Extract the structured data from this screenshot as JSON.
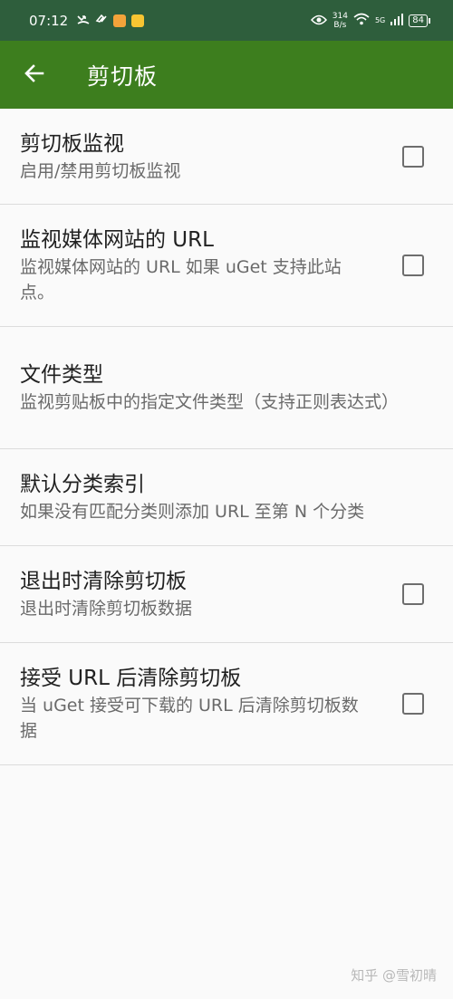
{
  "status_bar": {
    "time": "07:12",
    "net_speed_value": "314",
    "net_speed_unit": "B/s",
    "network_type": "5G",
    "battery": "84",
    "icons": [
      "missed-call-icon",
      "app-icon",
      "app-icon",
      "app-icon",
      "eye-icon",
      "wifi-icon",
      "signal-icon",
      "battery-icon"
    ]
  },
  "app_bar": {
    "title": "剪切板",
    "back_icon": "arrow-back-icon",
    "color": "#3d7e1e"
  },
  "preferences": [
    {
      "title": "剪切板监视",
      "summary": "启用/禁用剪切板监视",
      "has_checkbox": true,
      "checked": false
    },
    {
      "title": "监视媒体网站的 URL",
      "summary": "监视媒体网站的 URL 如果 uGet 支持此站点。",
      "has_checkbox": true,
      "checked": false
    },
    {
      "title": "文件类型",
      "summary": "监视剪贴板中的指定文件类型（支持正则表达式）",
      "has_checkbox": false
    },
    {
      "title": "默认分类索引",
      "summary": "如果没有匹配分类则添加 URL 至第 N 个分类",
      "has_checkbox": false
    },
    {
      "title": "退出时清除剪切板",
      "summary": "退出时清除剪切板数据",
      "has_checkbox": true,
      "checked": false
    },
    {
      "title": "接受 URL 后清除剪切板",
      "summary": "当 uGet 接受可下载的 URL 后清除剪切板数据",
      "has_checkbox": true,
      "checked": false
    }
  ],
  "watermark": "知乎 @雪初晴"
}
